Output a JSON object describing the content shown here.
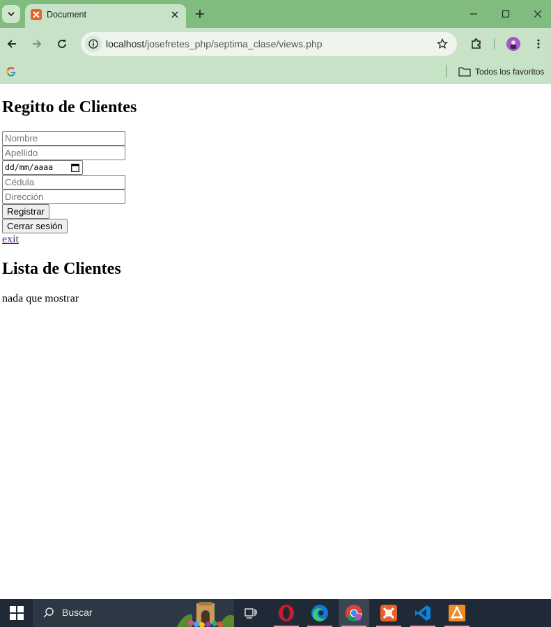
{
  "browser": {
    "tab_title": "Document",
    "url_host": "localhost",
    "url_path": "/josefretes_php/septima_clase/views.php",
    "bookmarks_folder": "Todos los favoritos",
    "theme_color": "#7fbc7e"
  },
  "page": {
    "register_heading": "Regitto de Clientes",
    "form": {
      "nombre_placeholder": "Nombre",
      "apellido_placeholder": "Apellido",
      "date_placeholder": "dd/mm/aaaa",
      "cedula_placeholder": "Cédula",
      "direccion_placeholder": "Dirección",
      "register_button": "Registrar",
      "logout_button": "Cerrar sesión"
    },
    "exit_link": "exit",
    "list_heading": "Lista de Clientes",
    "empty_message": "nada que mostrar"
  },
  "taskbar": {
    "search_label": "Buscar",
    "apps": [
      "task-view",
      "opera",
      "edge",
      "chrome",
      "xampp",
      "vscode",
      "sublime-merge"
    ]
  }
}
